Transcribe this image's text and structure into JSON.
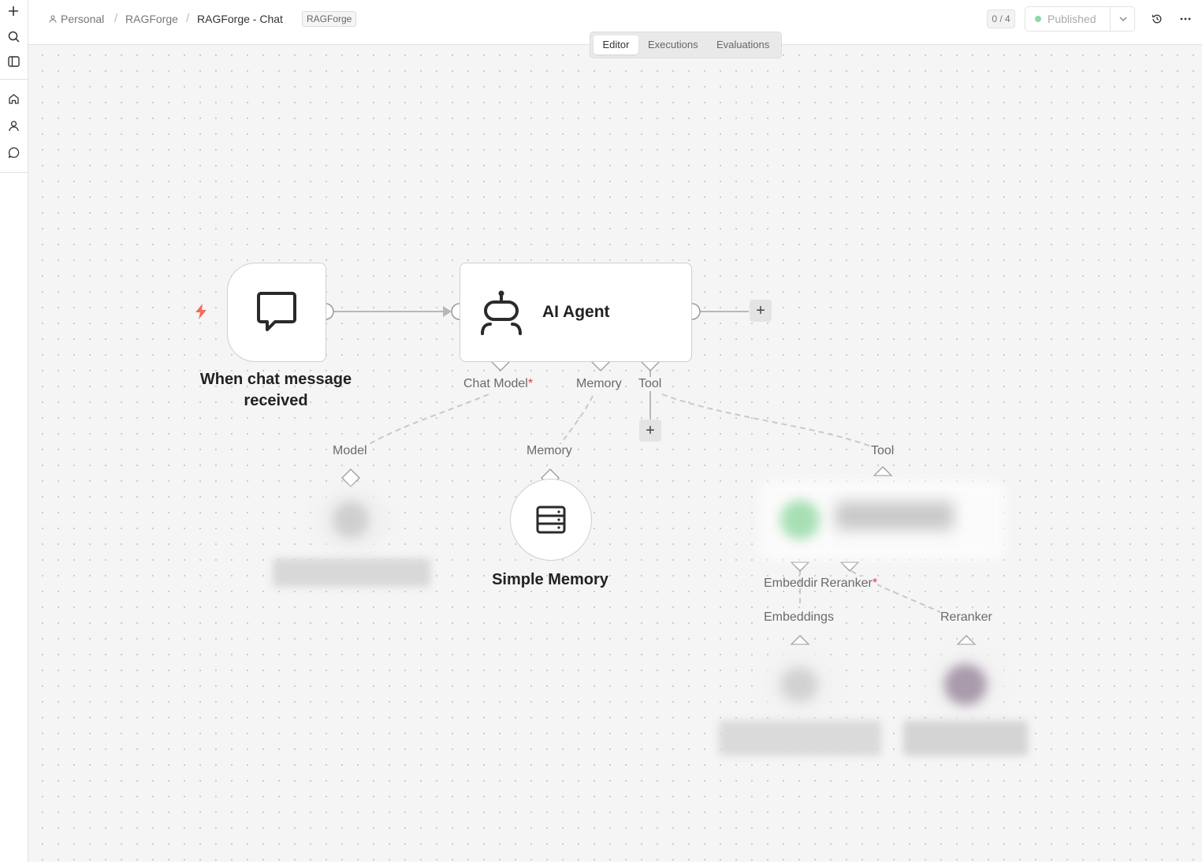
{
  "breadcrumb": {
    "owner": "Personal",
    "project": "RAGForge",
    "workflow": "RAGForge - Chat",
    "tag": "RAGForge",
    "separator": "/"
  },
  "header": {
    "counter": "0 / 4",
    "publish_status": "Published",
    "status_color": "#8fd8a8"
  },
  "tabs": [
    {
      "label": "Editor",
      "active": true
    },
    {
      "label": "Executions",
      "active": false
    },
    {
      "label": "Evaluations",
      "active": false
    }
  ],
  "sidebar": {
    "icons": [
      "plus-icon",
      "search-icon",
      "panel-icon",
      "home-icon",
      "user-icon",
      "chat-icon"
    ]
  },
  "nodes": {
    "trigger": {
      "label": "When chat message received",
      "icon": "chat-bubble-icon",
      "badge_color": "#f26b5b"
    },
    "agent": {
      "label": "AI Agent",
      "icon": "robot-icon"
    },
    "memory": {
      "label": "Simple Memory",
      "icon": "database-icon"
    }
  },
  "ports": {
    "chat_model": "Chat Model",
    "memory": "Memory",
    "tool": "Tool",
    "embeddings_truncated": "Embeddir",
    "reranker": "Reranker",
    "required_marker": "*"
  },
  "connections": {
    "model": "Model",
    "memory": "Memory",
    "tool": "Tool",
    "embeddings": "Embeddings",
    "reranker": "Reranker"
  },
  "add_symbol": "+"
}
